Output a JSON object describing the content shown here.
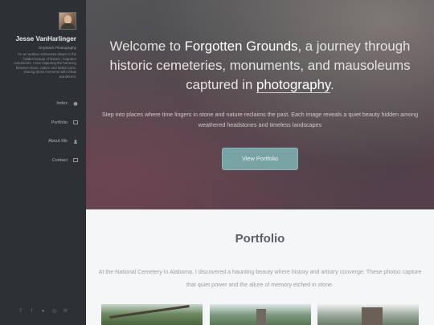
{
  "sidebar": {
    "name": "Jesse VanHarlinger",
    "subtitle": "TinyStack Photography",
    "bio": "I'm an outdoor enthusiast drawn to the hidden beauty of historic, forgotten cemeteries. I love capturing the harmony between stone, nature and faded icons, sharing those moments with fellow wanderers.",
    "nav": [
      {
        "label": "Index",
        "icon": "home-icon"
      },
      {
        "label": "Portfolio",
        "icon": "image-icon"
      },
      {
        "label": "About Me",
        "icon": "user-icon"
      },
      {
        "label": "Contact",
        "icon": "mail-icon"
      }
    ],
    "social": [
      "twitter-icon",
      "facebook-icon",
      "github-icon",
      "instagram-icon",
      "email-icon"
    ]
  },
  "hero": {
    "title_pre": "Welcome to ",
    "title_highlight": "Forgotten Grounds",
    "title_mid": ", a journey through historic cemeteries, monuments, and mausoleums captured in ",
    "title_link": "photography",
    "title_end": ".",
    "subtitle": "Step into places where time lingers in stone and nature reclaims the past. Each image reveals a quiet beauty hidden among weathered headstones and timeless landscapes",
    "button": "View Portfolio"
  },
  "portfolio": {
    "title": "Portfolio",
    "text": "At the National Cemetery in Alabama, I discovered a haunting beauty where history and artistry converge. These photos capture that quiet power and the allure of memory etched in stone."
  },
  "colors": {
    "sidebar_bg": "#2d3135",
    "button_bg": "#78a3a5",
    "section_bg": "#f4f6f8"
  }
}
